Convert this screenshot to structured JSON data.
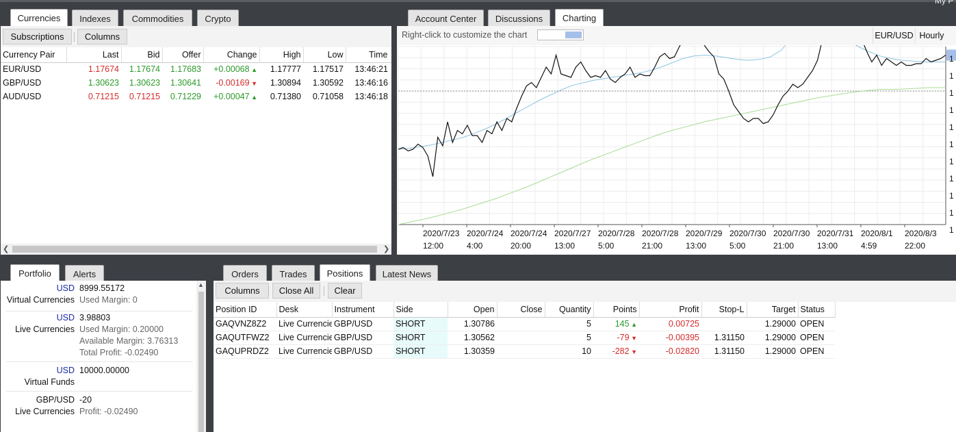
{
  "top_right_label": "My P",
  "currencies_panel": {
    "tabs": [
      "Currencies",
      "Indexes",
      "Commodities",
      "Crypto"
    ],
    "buttons": {
      "subscriptions": "Subscriptions",
      "columns": "Columns"
    },
    "headers": [
      "Currency Pair",
      "Last",
      "Bid",
      "Offer",
      "Change",
      "High",
      "Low",
      "Time"
    ],
    "rows": [
      {
        "pair": "EUR/USD",
        "last": "1.17674",
        "bid": "1.17674",
        "offer": "1.17683",
        "change": "+0.00068",
        "dir": "up",
        "high": "1.17777",
        "low": "1.17517",
        "time": "13:46:21",
        "last_color": "#d62b2b"
      },
      {
        "pair": "GBP/USD",
        "last": "1.30623",
        "bid": "1.30623",
        "offer": "1.30641",
        "change": "-0.00169",
        "dir": "down",
        "high": "1.30894",
        "low": "1.30592",
        "time": "13:46:16",
        "last_color": "#2a9a2a"
      },
      {
        "pair": "AUD/USD",
        "last": "0.71215",
        "bid": "0.71215",
        "offer": "0.71229",
        "change": "+0.00047",
        "dir": "up",
        "high": "0.71380",
        "low": "0.71058",
        "time": "13:46:18",
        "last_color": "#d62b2b"
      }
    ]
  },
  "chart_panel": {
    "tabs": [
      "Account Center",
      "Discussions",
      "Charting"
    ],
    "hint": "Right-click to customize the chart",
    "symbol": "EUR/USD",
    "interval": "Hourly",
    "y_tick_labels": [
      "1",
      "1",
      "1",
      "1",
      "1",
      "1",
      "1",
      "1",
      "1",
      "1",
      "1"
    ]
  },
  "chart_data": {
    "type": "line",
    "x_ticks": [
      [
        "2020/7/23",
        "12:00"
      ],
      [
        "2020/7/24",
        "4:00"
      ],
      [
        "2020/7/24",
        "20:00"
      ],
      [
        "2020/7/27",
        "13:00"
      ],
      [
        "2020/7/28",
        "5:00"
      ],
      [
        "2020/7/28",
        "21:00"
      ],
      [
        "2020/7/29",
        "13:00"
      ],
      [
        "2020/7/30",
        "5:00"
      ],
      [
        "2020/7/30",
        "21:00"
      ],
      [
        "2020/7/31",
        "13:00"
      ],
      [
        "2020/8/1",
        "4:59"
      ],
      [
        "2020/8/3",
        "22:00"
      ]
    ],
    "ylim": [
      0,
      100
    ],
    "reference_level": 78,
    "series": [
      {
        "color": "#111111",
        "values": [
          44,
          45,
          43,
          44,
          47,
          45,
          40,
          28,
          51,
          46,
          60,
          48,
          55,
          53,
          58,
          52,
          52,
          48,
          55,
          53,
          60,
          55,
          62,
          60,
          68,
          75,
          81,
          83,
          80,
          86,
          92,
          88,
          99,
          88,
          87,
          86,
          92,
          95,
          90,
          86,
          87,
          86,
          90,
          85,
          83,
          86,
          88,
          92,
          86,
          88,
          87,
          87,
          92,
          98,
          100,
          97,
          98,
          104,
          109,
          116,
          112,
          110,
          105,
          101,
          98,
          88,
          85,
          78,
          70,
          66,
          62,
          60,
          62,
          62,
          59,
          60,
          64,
          70,
          75,
          78,
          82,
          80,
          82,
          86,
          90,
          96,
          108,
          121,
          127,
          134,
          136,
          126,
          119,
          105,
          108,
          101,
          95,
          99,
          93,
          97,
          95,
          93,
          95,
          93,
          93,
          94,
          94,
          97,
          95,
          96,
          97,
          99
        ]
      },
      {
        "color": "#8cc4e2",
        "values": [
          44,
          44.5,
          45.5,
          46.5,
          48,
          49.5,
          51,
          53.5,
          56,
          59,
          62.5,
          66,
          69.5,
          73,
          76,
          79,
          81.5,
          83,
          84.5,
          85.5,
          86.5,
          87.5,
          88.5,
          90,
          92,
          94.5,
          97,
          98.5,
          99,
          98.5,
          97.5,
          96.5,
          96,
          96.5,
          98,
          102,
          110,
          118,
          121,
          116,
          111,
          108,
          104,
          101,
          98.5,
          97,
          96,
          95.5,
          95,
          95,
          95
        ]
      },
      {
        "color": "#a8dc94",
        "values": [
          0,
          2,
          4,
          6.5,
          9,
          12,
          15,
          18.5,
          22,
          26,
          30,
          34,
          38,
          41.5,
          45,
          48.5,
          52,
          55,
          57.5,
          60,
          62,
          64,
          66,
          68,
          70,
          72,
          74,
          75.5,
          77,
          78.2,
          79,
          79,
          79.5,
          80,
          80
        ]
      }
    ]
  },
  "portfolio_panel": {
    "tabs": [
      "Portfolio",
      "Alerts"
    ],
    "groups": [
      {
        "ccy": "USD",
        "name": "Virtual Currencies",
        "value": "8999.55172",
        "lines": [
          "Used Margin:  0"
        ]
      },
      {
        "ccy": "USD",
        "name": "Live Currencies",
        "value": "3.98803",
        "lines": [
          "Used Margin:  0.20000",
          "Available Margin:  3.76313",
          "Total Profit:  -0.02490"
        ]
      },
      {
        "ccy": "USD",
        "name": "Virtual Funds",
        "value": "10000.00000",
        "lines": []
      },
      {
        "ccy": "GBP/USD",
        "name": "Live Currencies",
        "value": "-20",
        "lines": [
          "Profit:  -0.02490"
        ]
      }
    ]
  },
  "positions_panel": {
    "tabs": [
      "Orders",
      "Trades",
      "Positions",
      "Latest News"
    ],
    "buttons": {
      "columns": "Columns",
      "close_all": "Close All",
      "clear": "Clear"
    },
    "headers": [
      "Position ID",
      "Desk",
      "Instrument",
      "Side",
      "Open",
      "Close",
      "Quantity",
      "Points",
      "Profit",
      "Stop-L",
      "Target",
      "Status"
    ],
    "rows": [
      {
        "id": "GAQVNZ8Z2",
        "desk": "Live Currencies",
        "instrument": "GBP/USD",
        "side": "SHORT",
        "open": "1.30786",
        "close": "",
        "qty": "5",
        "points": "145",
        "dir": "up",
        "profit": "0.00725",
        "stop": "",
        "target": "1.29000",
        "status": "OPEN"
      },
      {
        "id": "GAQUTFWZ2",
        "desk": "Live Currencies",
        "instrument": "GBP/USD",
        "side": "SHORT",
        "open": "1.30562",
        "close": "",
        "qty": "5",
        "points": "-79",
        "dir": "down",
        "profit": "-0.00395",
        "stop": "1.31150",
        "target": "1.29000",
        "status": "OPEN"
      },
      {
        "id": "GAQUPRDZ2",
        "desk": "Live Currencies",
        "instrument": "GBP/USD",
        "side": "SHORT",
        "open": "1.30359",
        "close": "",
        "qty": "10",
        "points": "-282",
        "dir": "down",
        "profit": "-0.02820",
        "stop": "1.31150",
        "target": "1.29000",
        "status": "OPEN"
      }
    ]
  },
  "colors": {
    "up": "#2a9a2a",
    "down": "#d62b2b",
    "accent": "#1a2aa0",
    "short_bg": "#e8fbfb"
  }
}
